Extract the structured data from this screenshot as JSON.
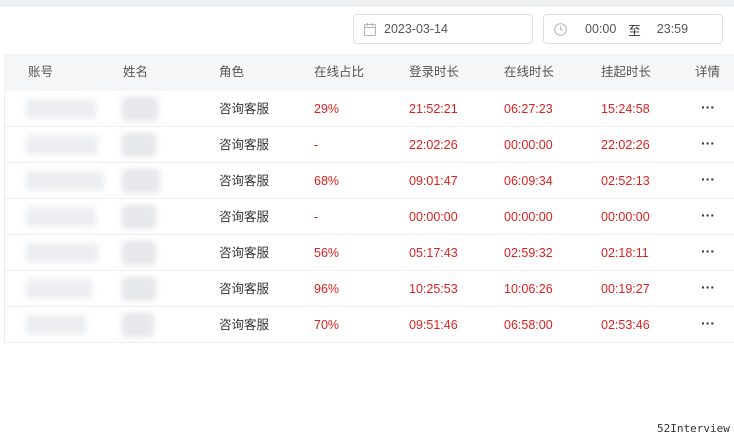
{
  "filters": {
    "date": "2023-03-14",
    "time_start": "00:00",
    "time_separator": "至",
    "time_end": "23:59"
  },
  "table": {
    "headers": {
      "account": "账号",
      "name": "姓名",
      "role": "角色",
      "online_ratio": "在线占比",
      "login_duration": "登录时长",
      "online_duration": "在线时长",
      "hold_duration": "挂起时长",
      "detail": "详情"
    },
    "rows": [
      {
        "account": "",
        "name": "",
        "role": "咨询客服",
        "online_ratio": "29%",
        "login_duration": "21:52:21",
        "online_duration": "06:27:23",
        "hold_duration": "15:24:58",
        "detail": "···"
      },
      {
        "account": "",
        "name": "",
        "role": "咨询客服",
        "online_ratio": "-",
        "login_duration": "22:02:26",
        "online_duration": "00:00:00",
        "hold_duration": "22:02:26",
        "detail": "···"
      },
      {
        "account": "",
        "name": "",
        "role": "咨询客服",
        "online_ratio": "68%",
        "login_duration": "09:01:47",
        "online_duration": "06:09:34",
        "hold_duration": "02:52:13",
        "detail": "···"
      },
      {
        "account": "",
        "name": "",
        "role": "咨询客服",
        "online_ratio": "-",
        "login_duration": "00:00:00",
        "online_duration": "00:00:00",
        "hold_duration": "00:00:00",
        "detail": "···"
      },
      {
        "account": "",
        "name": "",
        "role": "咨询客服",
        "online_ratio": "56%",
        "login_duration": "05:17:43",
        "online_duration": "02:59:32",
        "hold_duration": "02:18:11",
        "detail": "···"
      },
      {
        "account": "",
        "name": "",
        "role": "咨询客服",
        "online_ratio": "96%",
        "login_duration": "10:25:53",
        "online_duration": "10:06:26",
        "hold_duration": "00:19:27",
        "detail": "···"
      },
      {
        "account": "",
        "name": "",
        "role": "咨询客服",
        "online_ratio": "70%",
        "login_duration": "09:51:46",
        "online_duration": "06:58:00",
        "hold_duration": "02:53:46",
        "detail": "···"
      }
    ]
  },
  "watermark": "52Interview",
  "colors": {
    "accent_red": "#e02020",
    "header_bg": "#f5f6f8",
    "border": "#dcdfe6"
  },
  "icons": {
    "date": "calendar-icon",
    "time": "clock-icon",
    "more": "more-horizontal-icon"
  }
}
